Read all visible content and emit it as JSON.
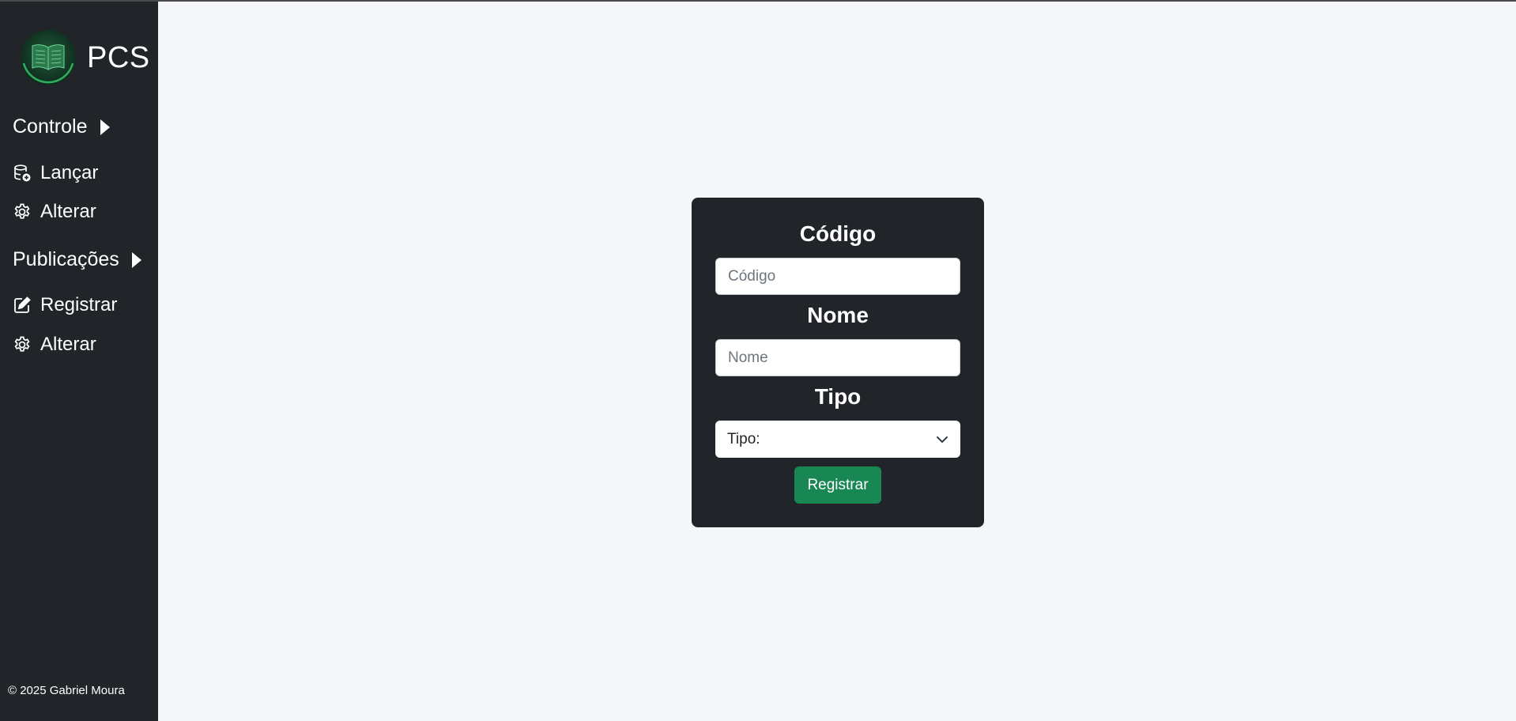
{
  "sidebar": {
    "brand": {
      "name": "PCS",
      "logo_icon": "open-book-icon"
    },
    "groups": [
      {
        "label": "Controle",
        "items": [
          {
            "label": "Lançar",
            "icon": "database-add-icon"
          },
          {
            "label": "Alterar",
            "icon": "gear-icon"
          }
        ]
      },
      {
        "label": "Publicações",
        "items": [
          {
            "label": "Registrar",
            "icon": "pencil-square-icon"
          },
          {
            "label": "Alterar",
            "icon": "gear-icon"
          }
        ]
      }
    ],
    "footer": "© 2025 Gabriel Moura"
  },
  "form": {
    "code_label": "Código",
    "code_placeholder": "Código",
    "code_value": "",
    "name_label": "Nome",
    "name_placeholder": "Nome",
    "name_value": "",
    "type_label": "Tipo",
    "type_selected": "Tipo:",
    "submit_label": "Registrar"
  },
  "colors": {
    "sidebar_bg": "#212529",
    "page_bg": "#f5f7fb",
    "card_bg": "#212529",
    "accent_green": "#198754"
  }
}
